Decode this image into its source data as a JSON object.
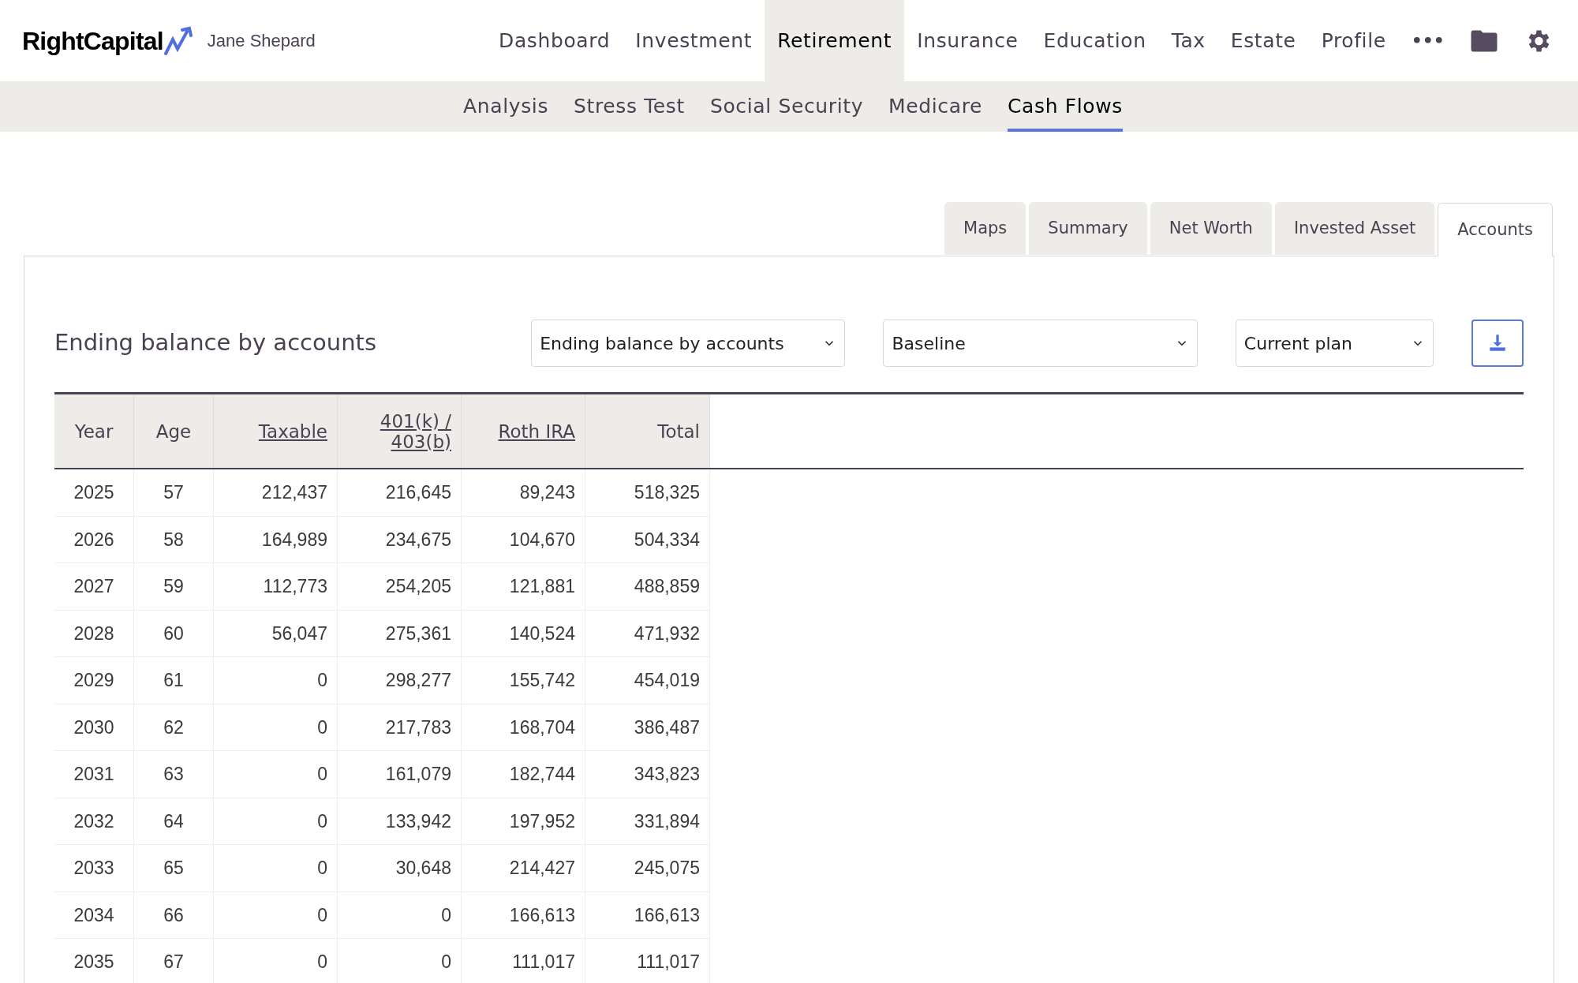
{
  "brand": {
    "name": "RightCapital",
    "user": "Jane Shepard"
  },
  "nav": [
    {
      "label": "Dashboard",
      "selected": false
    },
    {
      "label": "Investment",
      "selected": false
    },
    {
      "label": "Retirement",
      "selected": true
    },
    {
      "label": "Insurance",
      "selected": false
    },
    {
      "label": "Education",
      "selected": false
    },
    {
      "label": "Tax",
      "selected": false
    },
    {
      "label": "Estate",
      "selected": false
    },
    {
      "label": "Profile",
      "selected": false
    }
  ],
  "more": "•••",
  "subnav": [
    {
      "label": "Analysis",
      "selected": false
    },
    {
      "label": "Stress Test",
      "selected": false
    },
    {
      "label": "Social Security",
      "selected": false
    },
    {
      "label": "Medicare",
      "selected": false
    },
    {
      "label": "Cash Flows",
      "selected": true
    }
  ],
  "view_tabs": [
    {
      "label": "Maps",
      "selected": false
    },
    {
      "label": "Summary",
      "selected": false
    },
    {
      "label": "Net Worth",
      "selected": false
    },
    {
      "label": "Invested Asset",
      "selected": false
    },
    {
      "label": "Accounts",
      "selected": true
    }
  ],
  "panel": {
    "title": "Ending balance by accounts",
    "selects": [
      "Ending balance by accounts",
      "Baseline",
      "Current plan"
    ]
  },
  "table": {
    "columns": [
      {
        "label": "Year",
        "link": false
      },
      {
        "label": "Age",
        "link": false
      },
      {
        "label": "Taxable",
        "link": true
      },
      {
        "label": "401(k) / 403(b)",
        "link": true
      },
      {
        "label": "Roth IRA",
        "link": true
      },
      {
        "label": "Total",
        "link": false
      }
    ],
    "rows": [
      [
        "2025",
        "57",
        "212,437",
        "216,645",
        "89,243",
        "518,325"
      ],
      [
        "2026",
        "58",
        "164,989",
        "234,675",
        "104,670",
        "504,334"
      ],
      [
        "2027",
        "59",
        "112,773",
        "254,205",
        "121,881",
        "488,859"
      ],
      [
        "2028",
        "60",
        "56,047",
        "275,361",
        "140,524",
        "471,932"
      ],
      [
        "2029",
        "61",
        "0",
        "298,277",
        "155,742",
        "454,019"
      ],
      [
        "2030",
        "62",
        "0",
        "217,783",
        "168,704",
        "386,487"
      ],
      [
        "2031",
        "63",
        "0",
        "161,079",
        "182,744",
        "343,823"
      ],
      [
        "2032",
        "64",
        "0",
        "133,942",
        "197,952",
        "331,894"
      ],
      [
        "2033",
        "65",
        "0",
        "30,648",
        "214,427",
        "245,075"
      ],
      [
        "2034",
        "66",
        "0",
        "0",
        "166,613",
        "166,613"
      ],
      [
        "2035",
        "67",
        "0",
        "0",
        "111,017",
        "111,017"
      ]
    ]
  }
}
